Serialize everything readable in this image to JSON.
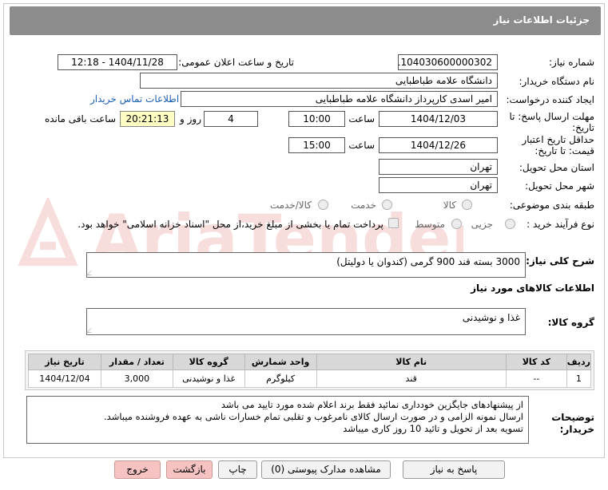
{
  "header": {
    "title": "جزئیات اطلاعات نیاز"
  },
  "fields": {
    "need_number_label": "شماره نیاز:",
    "need_number": "1104030600000302",
    "announce_label": "تاریخ و ساعت اعلان عمومی:",
    "announce_value": "1404/11/28 - 12:18",
    "buyer_org_label": "نام دستگاه خریدار:",
    "buyer_org": "دانشگاه علامه طباطبایی",
    "requester_label": "ایجاد کننده درخواست:",
    "requester": "امیر اسدی کارپرداز دانشگاه علامه طباطبایی",
    "contact_link": "اطلاعات تماس خریدار",
    "deadline_label_1": "مهلت ارسال پاسخ: تا",
    "deadline_label_2": "تاریخ:",
    "deadline_date": "1404/12/03",
    "time_label": "ساعت",
    "deadline_time": "10:00",
    "days_value": "4",
    "days_label": "روز و",
    "remaining_time": "20:21:13",
    "remaining_label": "ساعت باقی مانده",
    "validity_label_1": "حداقل تاریخ اعتبار",
    "validity_label_2": "قیمت: تا تاریخ:",
    "validity_date": "1404/12/26",
    "validity_time": "15:00",
    "province_label": "استان محل تحویل:",
    "province": "تهران",
    "city_label": "شهر محل تحویل:",
    "city": "تهران",
    "category_label": "طبقه بندی موضوعی:",
    "category_options": [
      "کالا",
      "خدمت",
      "کالا/خدمت"
    ],
    "process_label": "نوع فرآیند خرید :",
    "process_options": [
      "جزیی",
      "متوسط"
    ],
    "payment_text": "پرداخت تمام یا بخشی از مبلغ خرید،از محل \"اسناد خزانه اسلامی\" خواهد بود."
  },
  "description": {
    "label": "شرح کلی نیاز:",
    "value": "3000 بسته قند 900 گرمی (کندوان یا دولیتل)"
  },
  "goods_section": {
    "title": "اطلاعات کالاهای مورد نیاز",
    "group_label": "گروه کالا:",
    "group_value": "غذا و نوشیدنی"
  },
  "table": {
    "headers": [
      "ردیف",
      "کد کالا",
      "نام کالا",
      "واحد شمارش",
      "گروه کالا",
      "تعداد / مقدار",
      "تاریخ نیاز"
    ],
    "rows": [
      [
        "1",
        "--",
        "قند",
        "کیلوگرم",
        "غذا و نوشیدنی",
        "3,000",
        "1404/12/04"
      ]
    ]
  },
  "notes": {
    "label_1": "توضیحات",
    "label_2": "خریدار:",
    "lines": [
      "از پیشنهادهای جایگزین خودداری نمائید فقط برند اعلام شده مورد تایید می باشد",
      "ارسال نمونه الزامی و در صورت ارسال کالای نامرغوب و تقلبی تمام خسارات ناشی به عهده فروشنده میباشد.",
      "تسویه بعد از تحویل و تائید 10 روز کاری میباشد"
    ]
  },
  "buttons": {
    "reply": "پاسخ به نیاز",
    "attachments": "مشاهده مدارک پیوستی (0)",
    "print": "چاپ",
    "back": "بازگشت",
    "exit": "خروج"
  },
  "watermark_icon": "aria-tender-logo-icon",
  "watermark_text": "AriaTender.neT"
}
